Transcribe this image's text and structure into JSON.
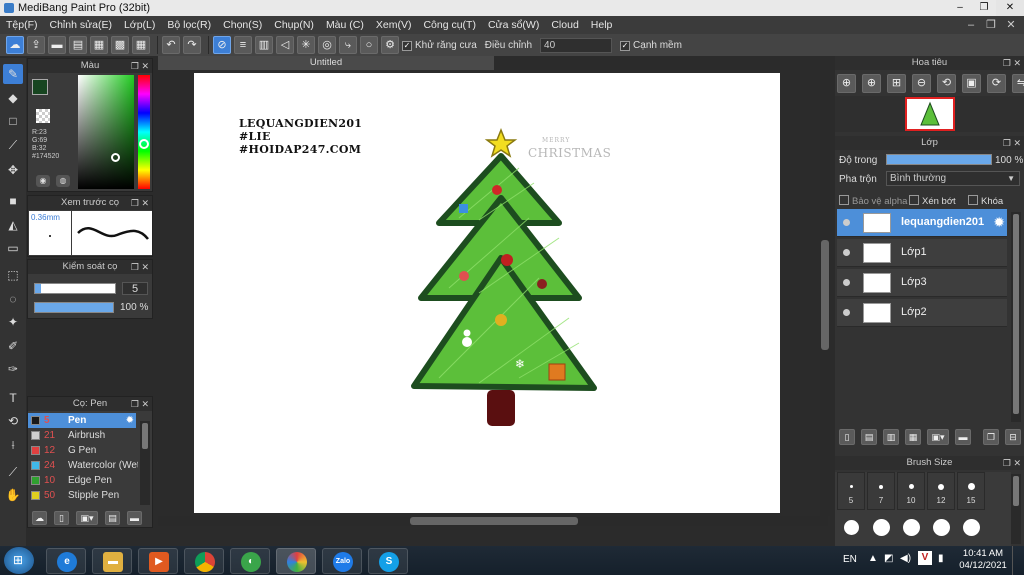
{
  "window": {
    "title": "MediBang Paint Pro (32bit)"
  },
  "menu": [
    "Tệp(F)",
    "Chỉnh sửa(E)",
    "Lớp(L)",
    "Bộ lọc(R)",
    "Chọn(S)",
    "Chụp(N)",
    "Màu (C)",
    "Xem(V)",
    "Công cụ(T)",
    "Cửa sổ(W)",
    "Cloud",
    "Help"
  ],
  "toolbar": {
    "antialias_label": "Khử răng cưa",
    "adjust_label": "Điều chỉnh",
    "adjust_value": "40",
    "smooth_label": "Cạnh mềm"
  },
  "color_panel": {
    "title": "Màu",
    "r": "R:23",
    "g": "G:69",
    "b": "B:32",
    "hex": "#174520",
    "foreground": "#174520",
    "background": "#ffffff"
  },
  "brush_preview": {
    "title": "Xem trước cọ",
    "size": "0.36mm"
  },
  "brush_control": {
    "title": "Kiểm soát cọ",
    "size_value": "5",
    "opacity_value": "100 %"
  },
  "brush_list": {
    "title": "Cọ: Pen",
    "items": [
      {
        "num": "5",
        "name": "Pen",
        "color": "#1a1a1a"
      },
      {
        "num": "21",
        "name": "Airbrush",
        "color": "#d0d0d0"
      },
      {
        "num": "12",
        "name": "G Pen",
        "color": "#e04040"
      },
      {
        "num": "24",
        "name": "Watercolor (Wet",
        "color": "#40b8e8"
      },
      {
        "num": "10",
        "name": "Edge Pen",
        "color": "#30a030"
      },
      {
        "num": "50",
        "name": "Stipple Pen",
        "color": "#e0d020"
      }
    ]
  },
  "document": {
    "tab_title": "Untitled",
    "watermark": [
      "LEQUANGDIEN201",
      "#LIE",
      "#HOIDAP247.COM"
    ],
    "xmas_top": "MERRY",
    "xmas_bottom": "CHRISTMAS"
  },
  "navigator": {
    "title": "Hoa tiêu"
  },
  "layer_panel": {
    "title": "Lớp",
    "opacity_label": "Độ trong",
    "opacity_value": "100 %",
    "blend_label": "Pha trộn",
    "blend_value": "Bình thường",
    "protect_alpha": "Bảo vệ alpha",
    "clipping": "Xén bớt",
    "lock": "Khóa",
    "layers": [
      "lequangdien201",
      "Lớp1",
      "Lớp3",
      "Lớp2"
    ]
  },
  "brush_size_panel": {
    "title": "Brush Size",
    "sizes": [
      "5",
      "7",
      "10",
      "12",
      "15"
    ]
  },
  "taskbar": {
    "lang": "EN",
    "time": "10:41 AM",
    "date": "04/12/2021",
    "zalo_label": "Zalo"
  }
}
